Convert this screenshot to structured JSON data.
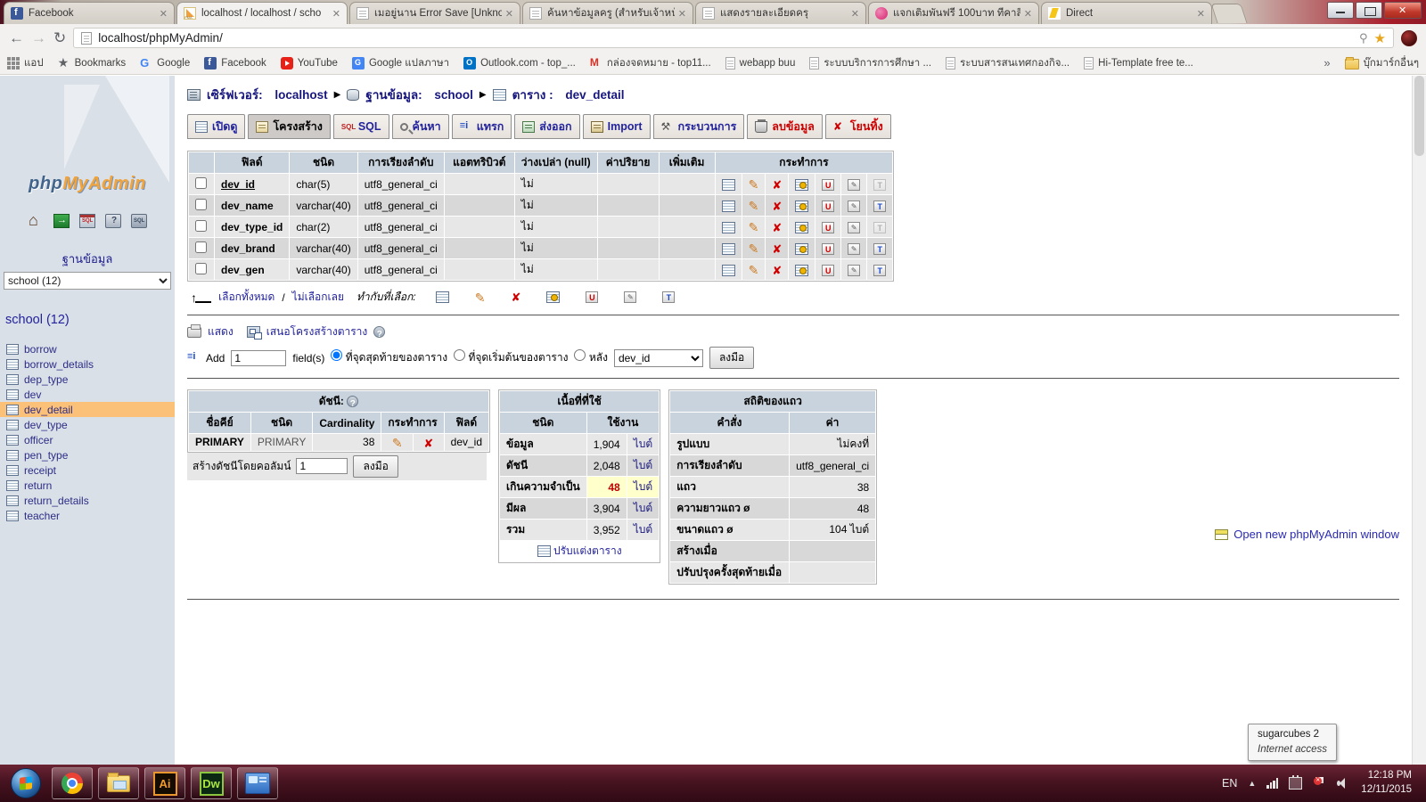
{
  "browser": {
    "tabs": [
      {
        "label": "Facebook"
      },
      {
        "label": "localhost / localhost / scho"
      },
      {
        "label": "เมอยู่นาน Error Save [Unkno"
      },
      {
        "label": "ค้นหาข้อมูลครู (สำหรับเจ้าหน้า"
      },
      {
        "label": "แสดงรายละเอียดครุ"
      },
      {
        "label": "แจกเติมพันฟรี 100บาท ทีคาสิ"
      },
      {
        "label": "Direct"
      }
    ],
    "close_glyph": "✕",
    "url": "localhost/phpMyAdmin/",
    "bookmarks": {
      "apps": "แอป",
      "bookmarks": "Bookmarks",
      "google": "Google",
      "facebook": "Facebook",
      "youtube": "YouTube",
      "translate": "Google แปลภาษา",
      "outlook": "Outlook.com - top_...",
      "mail": "กล่องจดหมาย - top11...",
      "webapp": "webapp buu",
      "edu": "ระบบบริการการศึกษา ...",
      "info": "ระบบสารสนเทศกองกิจ...",
      "hitemplate": "Hi-Template free te...",
      "chevron": "»",
      "other": "บุ๊กมาร์กอื่นๆ"
    }
  },
  "sidebar": {
    "logo_php": "php",
    "logo_my": "MyAdmin",
    "db_label": "ฐานข้อมูล",
    "db_selected": "school (12)",
    "db_heading": "school (12)",
    "tables": [
      "borrow",
      "borrow_details",
      "dep_type",
      "dev",
      "dev_detail",
      "dev_type",
      "officer",
      "pen_type",
      "receipt",
      "return",
      "return_details",
      "teacher"
    ]
  },
  "breadcrumb": {
    "server_label": "เซิร์ฟเวอร์:",
    "server": "localhost",
    "db_label": "ฐานข้อมูล:",
    "db": "school",
    "table_label": "ตาราง :",
    "table": "dev_detail"
  },
  "tabs": {
    "browse": "เปิดดู",
    "structure": "โครงสร้าง",
    "sql": "SQL",
    "search": "ค้นหา",
    "insert": "แทรก",
    "export": "ส่งออก",
    "import": "Import",
    "operations": "กระบวนการ",
    "empty": "ลบข้อมูล",
    "drop": "โยนทิ้ง"
  },
  "structure": {
    "headers": {
      "field": "ฟิลด์",
      "type": "ชนิด",
      "collation": "การเรียงลำดับ",
      "attributes": "แอตทริบิวต์",
      "null": "ว่างเปล่า (null)",
      "default": "ค่าปริยาย",
      "extra": "เพิ่มเติม",
      "action": "กระทำการ"
    },
    "rows": [
      {
        "field": "dev_id",
        "type": "char(5)",
        "collation": "utf8_general_ci",
        "nullable": "ไม่"
      },
      {
        "field": "dev_name",
        "type": "varchar(40)",
        "collation": "utf8_general_ci",
        "nullable": "ไม่"
      },
      {
        "field": "dev_type_id",
        "type": "char(2)",
        "collation": "utf8_general_ci",
        "nullable": "ไม่"
      },
      {
        "field": "dev_brand",
        "type": "varchar(40)",
        "collation": "utf8_general_ci",
        "nullable": "ไม่"
      },
      {
        "field": "dev_gen",
        "type": "varchar(40)",
        "collation": "utf8_general_ci",
        "nullable": "ไม่"
      }
    ],
    "check_all": "เลือกทั้งหมด",
    "sep": "/",
    "uncheck_all": "ไม่เลือกเลย",
    "with_selected": "ทำกับที่เลือก:"
  },
  "toolbar_links": {
    "print": "แสดง",
    "propose": "เสนอโครงสร้างตาราง"
  },
  "add_field": {
    "add": "Add",
    "count": "1",
    "fields": "field(s)",
    "at_end": "ที่จุดสุดท้ายของตาราง",
    "at_begin": "ที่จุดเริ่มต้นของตาราง",
    "after": "หลัง",
    "after_value": "dev_id",
    "go": "ลงมือ"
  },
  "indexes": {
    "title": "ดัชนี:",
    "headers": {
      "keyname": "ชื่อคีย์",
      "type": "ชนิด",
      "cardinality": "Cardinality",
      "action": "กระทำการ",
      "field": "ฟิลด์"
    },
    "row": {
      "keyname": "PRIMARY",
      "type": "PRIMARY",
      "cardinality": "38",
      "field": "dev_id"
    },
    "create_label": "สร้างดัชนีโดยคอลัมน์",
    "create_value": "1",
    "go": "ลงมือ"
  },
  "space": {
    "title": "เนื้อที่ที่ใช้",
    "headers": {
      "type": "ชนิด",
      "usage": "ใช้งาน"
    },
    "rows": [
      {
        "label": "ข้อมูล",
        "value": "1,904",
        "unit": "ไบต์"
      },
      {
        "label": "ดัชนี",
        "value": "2,048",
        "unit": "ไบต์"
      },
      {
        "label": "เกินความจำเป็น",
        "value": "48",
        "unit": "ไบต์"
      },
      {
        "label": "มีผล",
        "value": "3,904",
        "unit": "ไบต์"
      },
      {
        "label": "รวม",
        "value": "3,952",
        "unit": "ไบต์"
      }
    ],
    "optimize": "ปรับแต่งตาราง"
  },
  "row_stats": {
    "title": "สถิติของแถว",
    "headers": {
      "statement": "คำสั่ง",
      "value": "ค่า"
    },
    "rows": [
      {
        "label": "รูปแบบ",
        "value": "ไม่คงที่"
      },
      {
        "label": "การเรียงลำดับ",
        "value": "utf8_general_ci"
      },
      {
        "label": "แถว",
        "value": "38"
      },
      {
        "label": "ความยาวแถว ø",
        "value": "48"
      },
      {
        "label": "ขนาดแถว ø",
        "value": "104 ไบต์"
      },
      {
        "label": "สร้างเมื่อ",
        "value": ""
      },
      {
        "label": "ปรับปรุงครั้งสุดท้ายเมื่อ",
        "value": ""
      }
    ]
  },
  "footer": {
    "open_new": "Open new phpMyAdmin window"
  },
  "tooltip": {
    "line1": "sugarcubes 2",
    "line2": "Internet access"
  },
  "taskbar": {
    "lang": "EN",
    "time": "12:18 PM",
    "date": "12/11/2015"
  },
  "colors": {
    "selected_table_bg": "#fbc178",
    "link_blue": "#23239c",
    "header_bg": "#c9d3dd",
    "overhead_red": "#c00000",
    "overhead_bg": "#ffffcc",
    "taskbar": "#471321"
  }
}
